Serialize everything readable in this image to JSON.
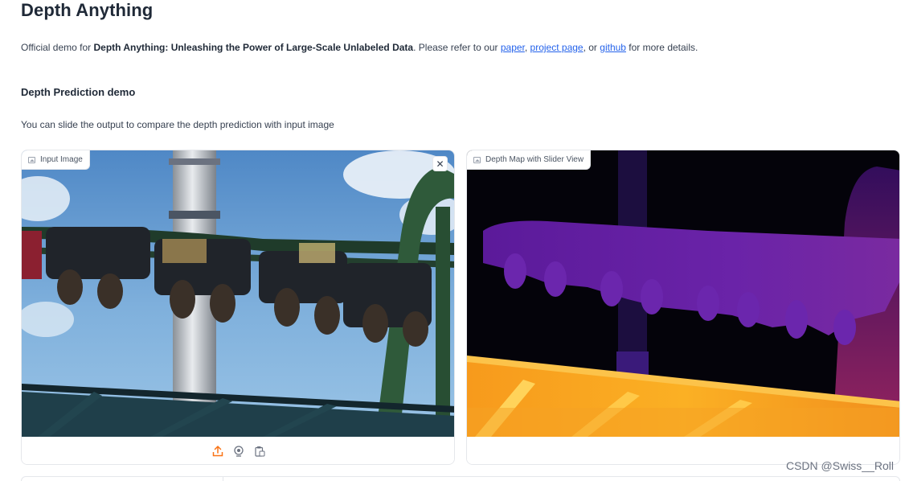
{
  "page": {
    "title": "Depth Anything",
    "intro_prefix": "Official demo for ",
    "intro_bold": "Depth Anything: Unleashing the Power of Large-Scale Unlabeled Data",
    "intro_middle": ". Please refer to our ",
    "link_paper": "paper",
    "sep1": ", ",
    "link_project": "project page",
    "sep2": ", or ",
    "link_github": "github",
    "intro_suffix": " for more details.",
    "section_title": "Depth Prediction demo",
    "description": "You can slide the output to compare the depth prediction with input image"
  },
  "input_panel": {
    "label": "Input Image",
    "close_symbol": "✕",
    "icons": [
      "upload-icon",
      "webcam-icon",
      "clipboard-icon"
    ]
  },
  "output_panel": {
    "label": "Depth Map with Slider View"
  },
  "watermark": "CSDN @Swiss__Roll",
  "colors": {
    "link": "#2563eb",
    "accent": "#f97316",
    "border": "#e5e7eb"
  }
}
